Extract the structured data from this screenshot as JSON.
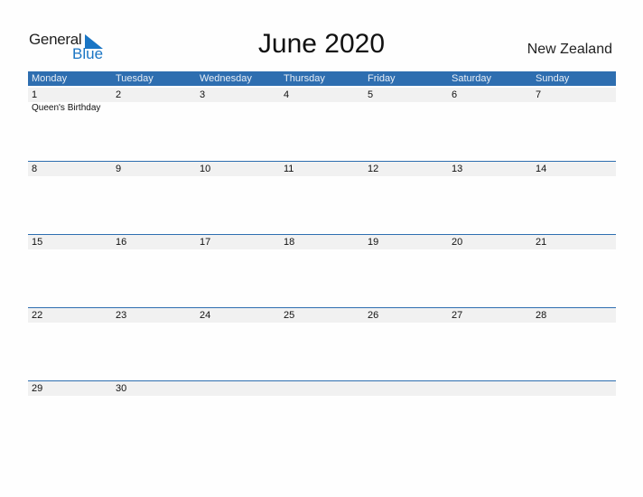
{
  "logo": {
    "general": "General",
    "blue": "Blue",
    "accent_color": "#1a75c4"
  },
  "title": "June 2020",
  "country": "New Zealand",
  "weekdays": [
    "Monday",
    "Tuesday",
    "Wednesday",
    "Thursday",
    "Friday",
    "Saturday",
    "Sunday"
  ],
  "weeks": [
    {
      "days": [
        "1",
        "2",
        "3",
        "4",
        "5",
        "6",
        "7"
      ],
      "events": [
        "Queen's Birthday",
        "",
        "",
        "",
        "",
        "",
        ""
      ]
    },
    {
      "days": [
        "8",
        "9",
        "10",
        "11",
        "12",
        "13",
        "14"
      ],
      "events": [
        "",
        "",
        "",
        "",
        "",
        "",
        ""
      ]
    },
    {
      "days": [
        "15",
        "16",
        "17",
        "18",
        "19",
        "20",
        "21"
      ],
      "events": [
        "",
        "",
        "",
        "",
        "",
        "",
        ""
      ]
    },
    {
      "days": [
        "22",
        "23",
        "24",
        "25",
        "26",
        "27",
        "28"
      ],
      "events": [
        "",
        "",
        "",
        "",
        "",
        "",
        ""
      ]
    },
    {
      "days": [
        "29",
        "30",
        "",
        "",
        "",
        "",
        ""
      ],
      "events": [
        "",
        "",
        "",
        "",
        "",
        "",
        ""
      ]
    }
  ],
  "colors": {
    "header_bg": "#2e6eb0",
    "date_strip_bg": "#f1f1f1"
  }
}
